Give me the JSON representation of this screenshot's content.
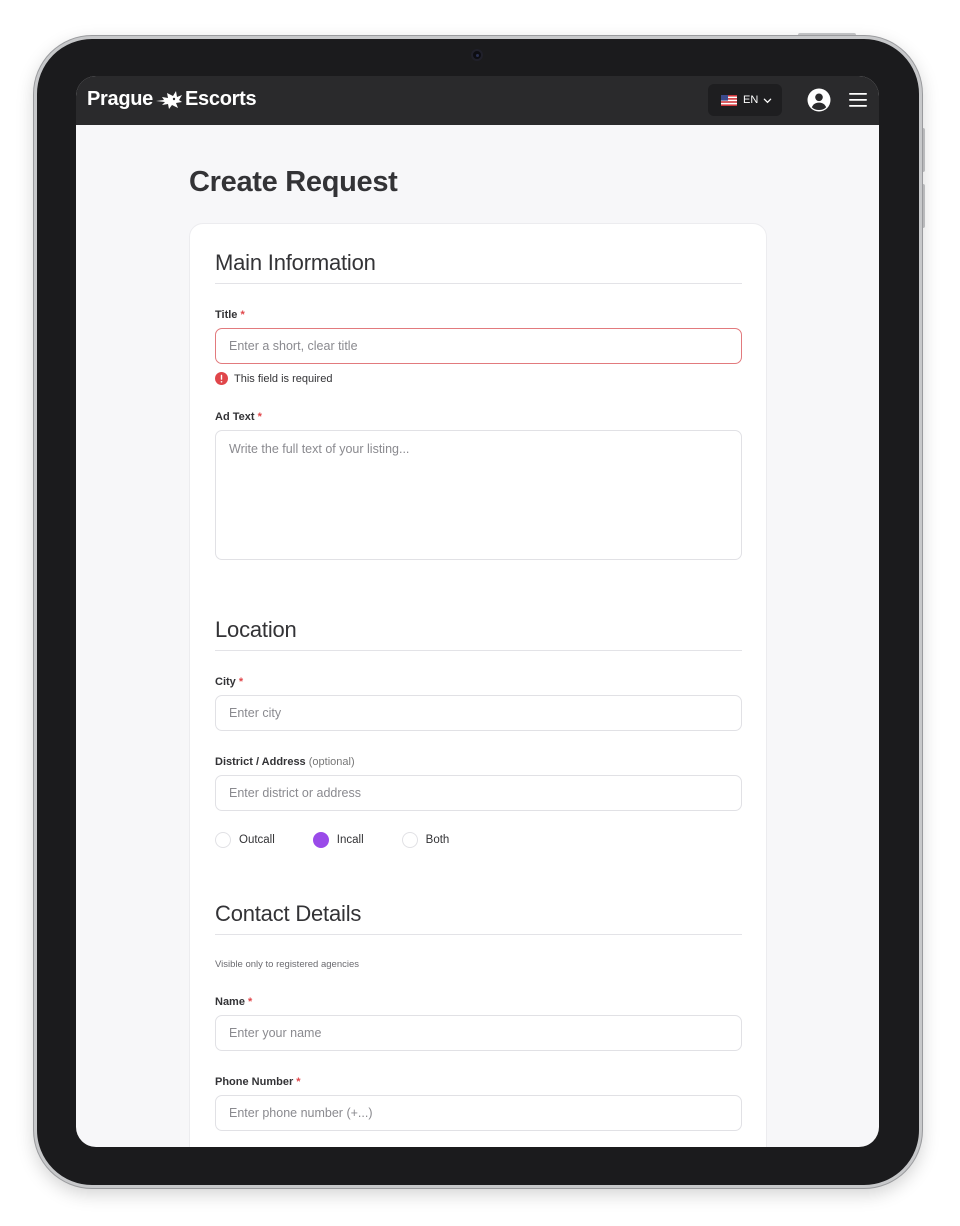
{
  "header": {
    "logo_left": "Prague",
    "logo_right": "Escorts",
    "language": "EN"
  },
  "page": {
    "title": "Create Request"
  },
  "main_information": {
    "heading": "Main Information",
    "title_label": "Title",
    "title_placeholder": "Enter a short, clear title",
    "title_error": "This field is required",
    "ad_text_label": "Ad Text",
    "ad_text_placeholder": "Write the full text of your listing..."
  },
  "location": {
    "heading": "Location",
    "city_label": "City",
    "city_placeholder": "Enter city",
    "district_label": "District / Address",
    "district_optional": "(optional)",
    "district_placeholder": "Enter district or address",
    "options": [
      {
        "label": "Outcall",
        "selected": false
      },
      {
        "label": "Incall",
        "selected": true
      },
      {
        "label": "Both",
        "selected": false
      }
    ]
  },
  "contact": {
    "heading": "Contact Details",
    "hint": "Visible only to registered agencies",
    "name_label": "Name",
    "name_placeholder": "Enter your name",
    "phone_label": "Phone Number",
    "phone_placeholder": "Enter phone number (+...)"
  },
  "required_marker": "*",
  "colors": {
    "navbar": "#2a2a2c",
    "accent_purple": "#9a4be9",
    "error_red": "#e0464a"
  }
}
